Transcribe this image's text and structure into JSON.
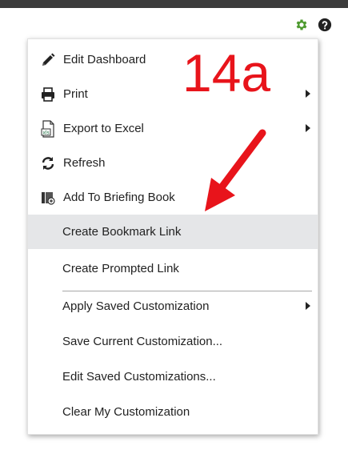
{
  "annotation": {
    "label": "14a",
    "color": "#e8141b"
  },
  "top_icons": [
    {
      "icon": "gear-icon",
      "color": "#4d9a2e"
    },
    {
      "icon": "help-icon",
      "color": "#222222"
    }
  ],
  "menu": {
    "items": [
      {
        "label": "Edit Dashboard",
        "icon": "pencil-icon",
        "submenu": false
      },
      {
        "label": "Print",
        "icon": "printer-icon",
        "submenu": true
      },
      {
        "label": "Export to Excel",
        "icon": "excel-export-icon",
        "submenu": true
      },
      {
        "label": "Refresh",
        "icon": "refresh-icon",
        "submenu": false
      },
      {
        "label": "Add To Briefing Book",
        "icon": "briefing-book-icon",
        "submenu": false
      },
      {
        "label": "Create Bookmark Link",
        "highlighted": true,
        "submenu": false
      },
      {
        "label": "Create Prompted Link",
        "submenu": false
      },
      {
        "label": "Apply Saved Customization",
        "submenu": true
      },
      {
        "label": "Save Current Customization...",
        "submenu": false
      },
      {
        "label": "Edit Saved Customizations...",
        "submenu": false
      },
      {
        "label": "Clear My Customization",
        "submenu": false
      }
    ]
  }
}
